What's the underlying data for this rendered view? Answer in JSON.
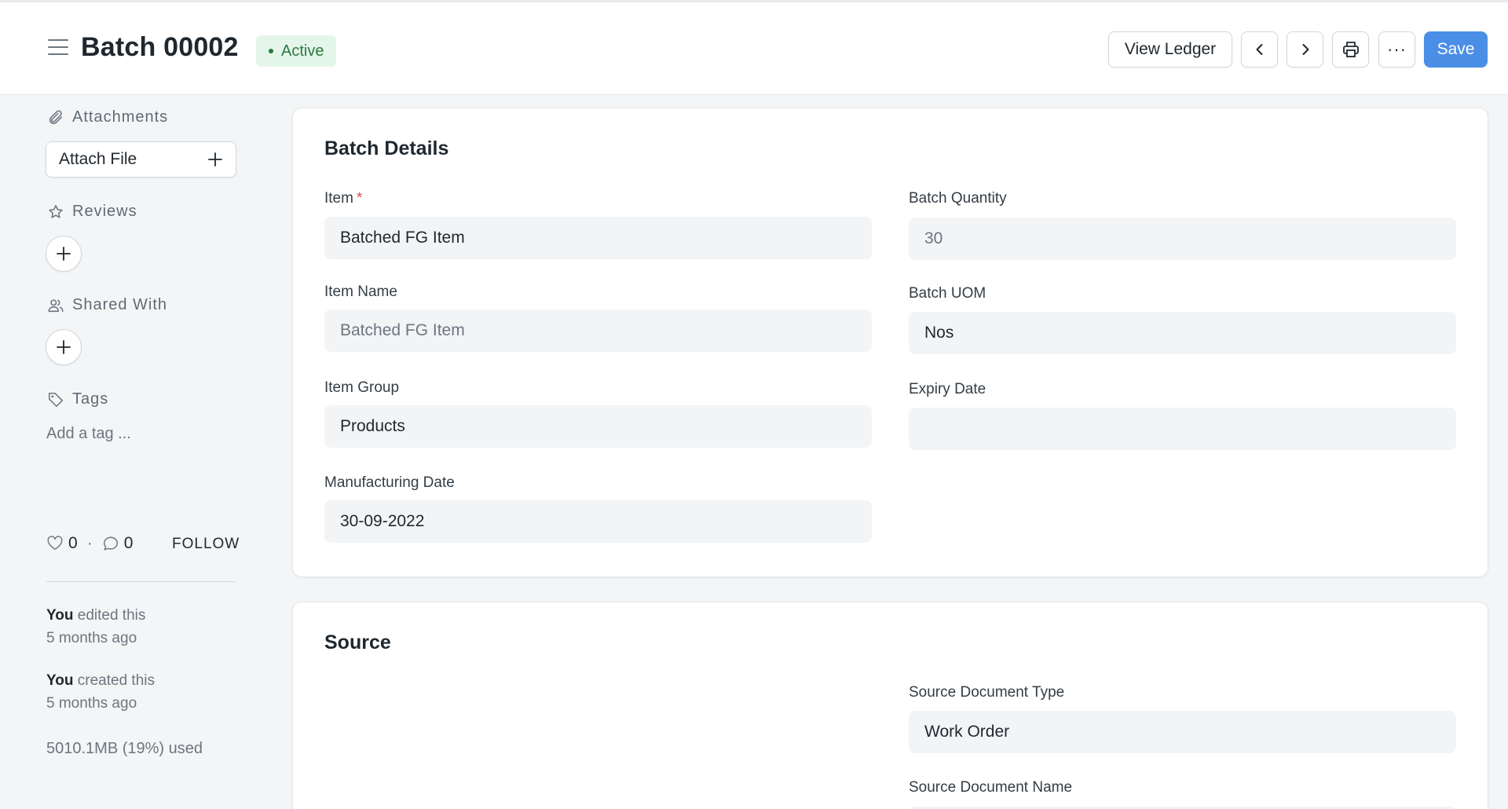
{
  "header": {
    "title": "Batch 00002",
    "status": "Active",
    "buttons": {
      "view_ledger": "View Ledger",
      "more": "···",
      "save": "Save"
    }
  },
  "sidebar": {
    "attachments": {
      "label": "Attachments",
      "attach_file": "Attach File"
    },
    "reviews": {
      "label": "Reviews"
    },
    "shared_with": {
      "label": "Shared With"
    },
    "tags": {
      "label": "Tags",
      "add_tag": "Add a tag ..."
    },
    "stats": {
      "likes": "0",
      "separator": "·",
      "comments": "0",
      "follow": "FOLLOW"
    },
    "activity": [
      {
        "actor": "You",
        "action": " edited this",
        "time": "5 months ago"
      },
      {
        "actor": "You",
        "action": " created this",
        "time": "5 months ago"
      }
    ],
    "usage": "5010.1MB (19%) used"
  },
  "batch_details": {
    "title": "Batch Details",
    "item": {
      "label": "Item",
      "required": "*",
      "value": "Batched FG Item"
    },
    "item_name": {
      "label": "Item Name",
      "value": "Batched FG Item"
    },
    "item_group": {
      "label": "Item Group",
      "value": "Products"
    },
    "manufacturing_date": {
      "label": "Manufacturing Date",
      "value": "30-09-2022"
    },
    "batch_quantity": {
      "label": "Batch Quantity",
      "value": "30"
    },
    "batch_uom": {
      "label": "Batch UOM",
      "value": "Nos"
    },
    "expiry_date": {
      "label": "Expiry Date",
      "value": ""
    }
  },
  "source": {
    "title": "Source",
    "source_document_type": {
      "label": "Source Document Type",
      "value": "Work Order"
    },
    "source_document_name": {
      "label": "Source Document Name",
      "value": ""
    }
  },
  "colors": {
    "primary": "#4b8ee6",
    "status_bg": "#e4f5e9",
    "status_text": "#2b7a3e",
    "required": "#e24c4c"
  }
}
